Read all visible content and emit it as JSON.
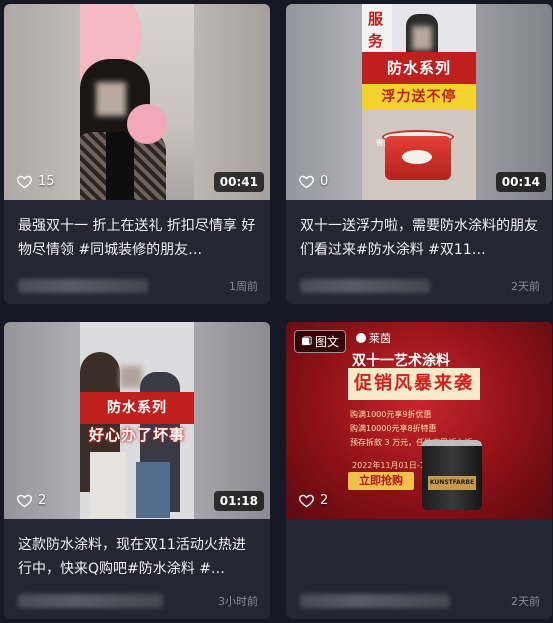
{
  "cards": [
    {
      "likes": "15",
      "duration": "00:41",
      "description": "最强双十一 折上在送礼 折扣尽情享 好物尽情领 #同城装修的朋友…",
      "time": "1周前"
    },
    {
      "likes": "0",
      "duration": "00:14",
      "description": "双十一送浮力啦，需要防水涂料的朋友们看过来#防水涂料 #双11…",
      "time": "2天前",
      "overlay": {
        "banner_top": "防水系列",
        "banner_bottom": "浮力送不停",
        "wall_text": "服\n务",
        "caption": "需要就送"
      }
    },
    {
      "likes": "2",
      "duration": "01:18",
      "description": "这款防水涂料，现在双11活动火热进行中，快来Q购吧#防水涂料 #…",
      "time": "3小时前",
      "overlay": {
        "banner_top": "防水系列",
        "banner_bottom": "好心办了坏事"
      }
    },
    {
      "likes": "2",
      "badge": "图文",
      "description": "",
      "time": "2天前",
      "poster": {
        "brand": "莱茵",
        "title": "双十一艺术涂料",
        "slogan": "促销风暴来袭",
        "offers": [
          "购满1000元享9折优惠",
          "购满10000元享8折特惠",
          "预存拆款 3 万元，任性享受折上折"
        ],
        "date": "2022年11月01日-11日",
        "button": "立即抢购",
        "product": "KUNSTFARBE"
      }
    }
  ],
  "colors": {
    "background": "#161823",
    "card": "#252632",
    "accent_red": "#c0201d"
  }
}
